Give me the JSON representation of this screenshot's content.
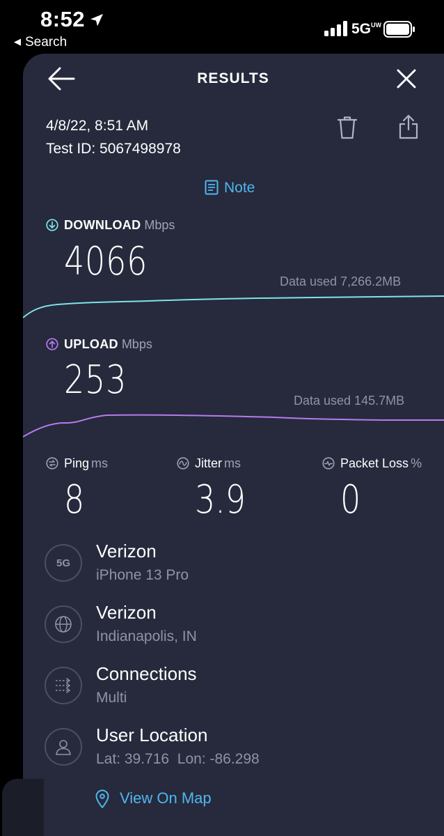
{
  "status_bar": {
    "time": "8:52",
    "back_label": "Search",
    "network": "5G",
    "network_suffix": "UW"
  },
  "header": {
    "title": "RESULTS"
  },
  "meta": {
    "date": "4/8/22, 8:51 AM",
    "test_id": "Test ID: 5067498978",
    "note_label": "Note"
  },
  "download": {
    "label": "DOWNLOAD",
    "unit": "Mbps",
    "value": "4066",
    "data_used": "Data used 7,266.2MB",
    "color": "#7fe3e8"
  },
  "upload": {
    "label": "UPLOAD",
    "unit": "Mbps",
    "value": "253",
    "data_used": "Data used 145.7MB",
    "color": "#b57bf0"
  },
  "stats": {
    "ping": {
      "label": "Ping",
      "unit": "ms",
      "value": "8"
    },
    "jitter": {
      "label": "Jitter",
      "unit": "ms",
      "value": "3.9"
    },
    "packet_loss": {
      "label": "Packet Loss",
      "unit": "%",
      "value": "0"
    }
  },
  "details": {
    "carrier": {
      "badge": "5G",
      "title": "Verizon",
      "subtitle": "iPhone 13 Pro"
    },
    "server": {
      "title": "Verizon",
      "subtitle": "Indianapolis, IN"
    },
    "connections": {
      "title": "Connections",
      "subtitle": "Multi"
    },
    "user_location": {
      "title": "User Location",
      "subtitle": "Lat: 39.716  Lon: -86.298"
    }
  },
  "view_on_map": "View On Map",
  "colors": {
    "background": "#262a3c",
    "accent": "#4fb7ef"
  }
}
